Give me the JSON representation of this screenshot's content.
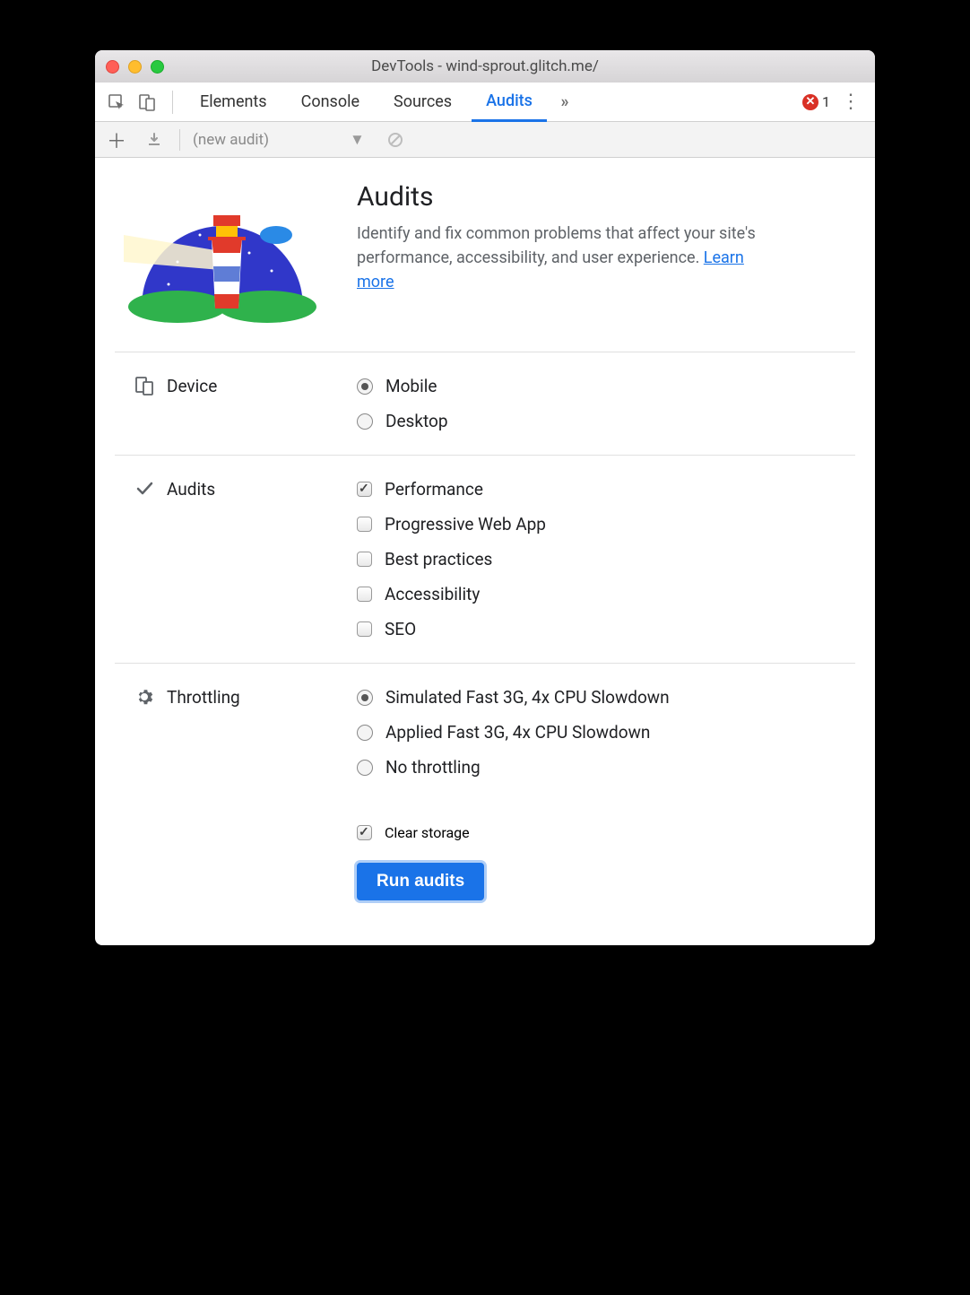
{
  "window": {
    "title": "DevTools - wind-sprout.glitch.me/"
  },
  "tabs": {
    "items": [
      "Elements",
      "Console",
      "Sources",
      "Audits"
    ],
    "active": "Audits",
    "overflow_glyph": "»",
    "error_count": "1"
  },
  "subbar": {
    "dropdown_label": "(new audit)"
  },
  "hero": {
    "title": "Audits",
    "desc_prefix": "Identify and fix common problems that affect your site's performance, accessibility, and user experience. ",
    "learn_more": "Learn more"
  },
  "sections": {
    "device": {
      "label": "Device",
      "options": [
        {
          "label": "Mobile",
          "checked": true
        },
        {
          "label": "Desktop",
          "checked": false
        }
      ]
    },
    "audits": {
      "label": "Audits",
      "options": [
        {
          "label": "Performance",
          "checked": true
        },
        {
          "label": "Progressive Web App",
          "checked": false
        },
        {
          "label": "Best practices",
          "checked": false
        },
        {
          "label": "Accessibility",
          "checked": false
        },
        {
          "label": "SEO",
          "checked": false
        }
      ]
    },
    "throttling": {
      "label": "Throttling",
      "options": [
        {
          "label": "Simulated Fast 3G, 4x CPU Slowdown",
          "checked": true
        },
        {
          "label": "Applied Fast 3G, 4x CPU Slowdown",
          "checked": false
        },
        {
          "label": "No throttling",
          "checked": false
        }
      ]
    }
  },
  "footer": {
    "clear_storage": {
      "label": "Clear storage",
      "checked": true
    },
    "run_label": "Run audits"
  }
}
